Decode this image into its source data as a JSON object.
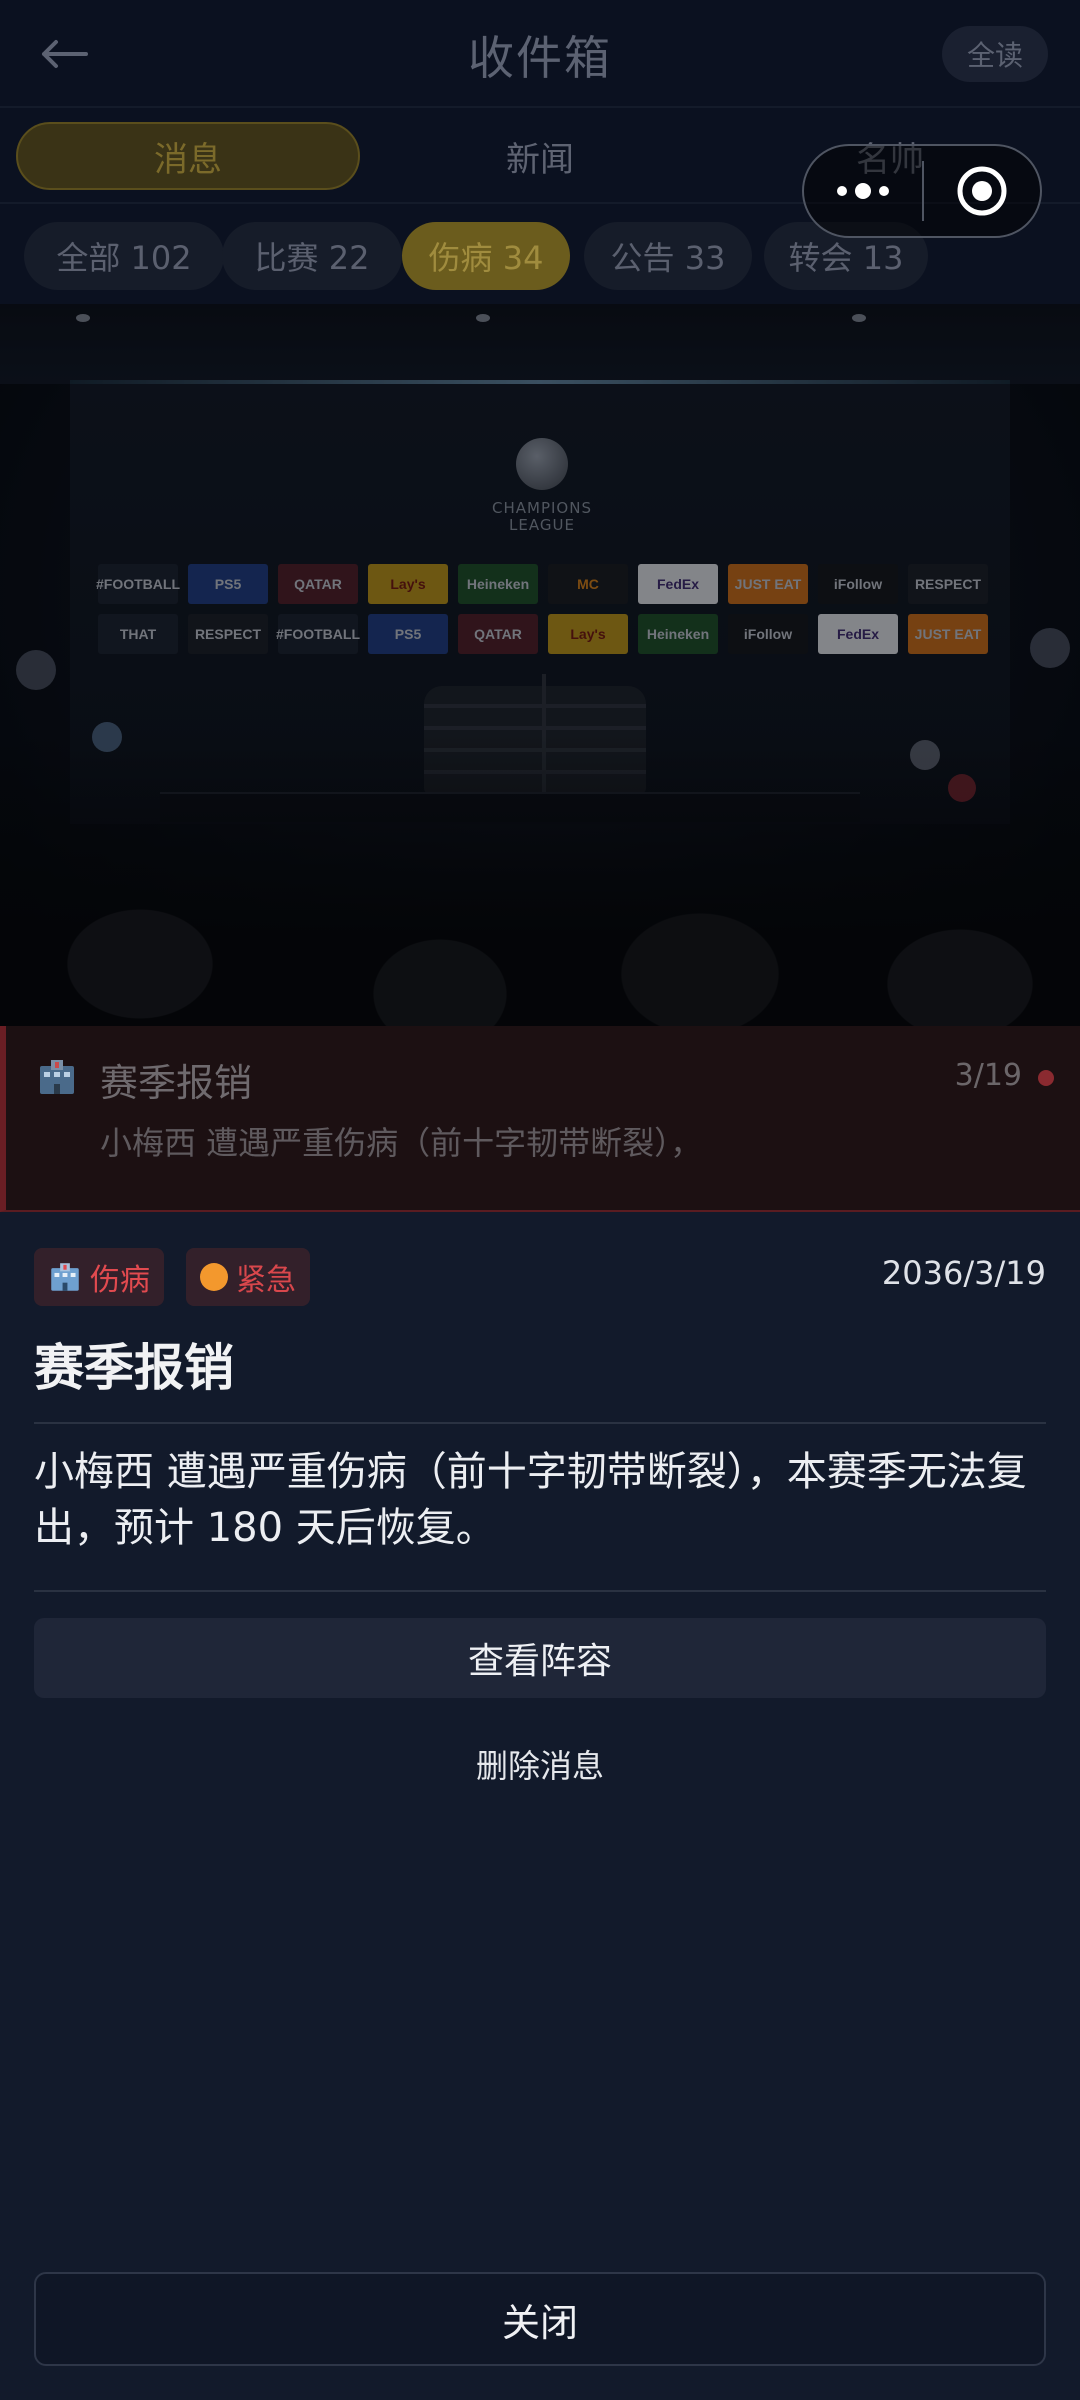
{
  "header": {
    "title": "收件箱",
    "read_all_label": "全读"
  },
  "tabs": [
    {
      "label": "消息",
      "active": true
    },
    {
      "label": "新闻",
      "active": false
    },
    {
      "label": "名帅",
      "active": false
    }
  ],
  "filters": [
    {
      "label": "全部 102",
      "active": false
    },
    {
      "label": "比赛 22",
      "active": false
    },
    {
      "label": "伤病 34",
      "active": true
    },
    {
      "label": "公告 33",
      "active": false
    },
    {
      "label": "转会 13",
      "active": false
    }
  ],
  "hero": {
    "logo_text": "CHAMPIONS LEAGUE",
    "sponsors_row1": [
      "#FOOTBALL",
      "PS5",
      "QATAR",
      "Lay's",
      "Heineken",
      "MC",
      "FedEx",
      "JUST EAT",
      "iFollow",
      "RESPECT"
    ],
    "sponsors_row2": [
      "THAT",
      "RESPECT",
      "#FOOTBALL",
      "PS5",
      "QATAR",
      "Lay's",
      "Heineken",
      "iFollow",
      "FedEx",
      "JUST EAT"
    ]
  },
  "list_item": {
    "icon": "hospital-icon",
    "title": "赛季报销",
    "date": "3/19",
    "preview": "小梅西 遭遇严重伤病（前十字韧带断裂），"
  },
  "detail": {
    "category_badge": "伤病",
    "priority_badge": "紧急",
    "date": "2036/3/19",
    "title": "赛季报销",
    "body": "小梅西 遭遇严重伤病（前十字韧带断裂），本赛季无法复出，预计 180 天后恢复。",
    "primary_action": "查看阵容",
    "delete_action": "删除消息",
    "close_action": "关闭"
  },
  "colors": {
    "accent_gold": "#6b5c1d",
    "injury_red": "#e14a4f",
    "urgent_orange": "#f3982d",
    "sheet_bg": "#121a2b"
  }
}
